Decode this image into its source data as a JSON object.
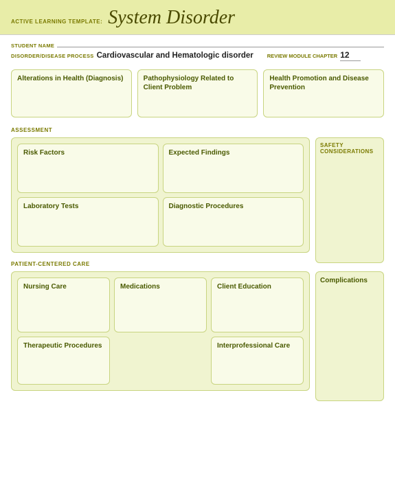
{
  "header": {
    "active_learning_label": "ACTIVE LEARNING TEMPLATE:",
    "template_type": "System Disorder"
  },
  "student": {
    "name_label": "STUDENT NAME",
    "disorder_label": "DISORDER/DISEASE PROCESS",
    "disorder_value": "Cardiovascular and Hematologic disorder",
    "review_label": "REVIEW MODULE CHAPTER",
    "chapter_value": "12"
  },
  "top_boxes": [
    {
      "title": "Alterations in Health (Diagnosis)"
    },
    {
      "title": "Pathophysiology Related to Client Problem"
    },
    {
      "title": "Health Promotion and Disease Prevention"
    }
  ],
  "assessment": {
    "section_label": "ASSESSMENT",
    "boxes": [
      {
        "title": "Risk Factors"
      },
      {
        "title": "Expected Findings"
      },
      {
        "title": "Laboratory Tests"
      },
      {
        "title": "Diagnostic Procedures"
      }
    ]
  },
  "safety": {
    "title": "SAFETY CONSIDERATIONS"
  },
  "patient_centered_care": {
    "section_label": "PATIENT-CENTERED CARE",
    "nursing_label": "Nursing Care",
    "medications_label": "Medications",
    "education_label": "Client Education",
    "therapeutic_label": "Therapeutic Procedures",
    "interprofessional_label": "Interprofessional Care"
  },
  "complications": {
    "title": "Complications"
  }
}
